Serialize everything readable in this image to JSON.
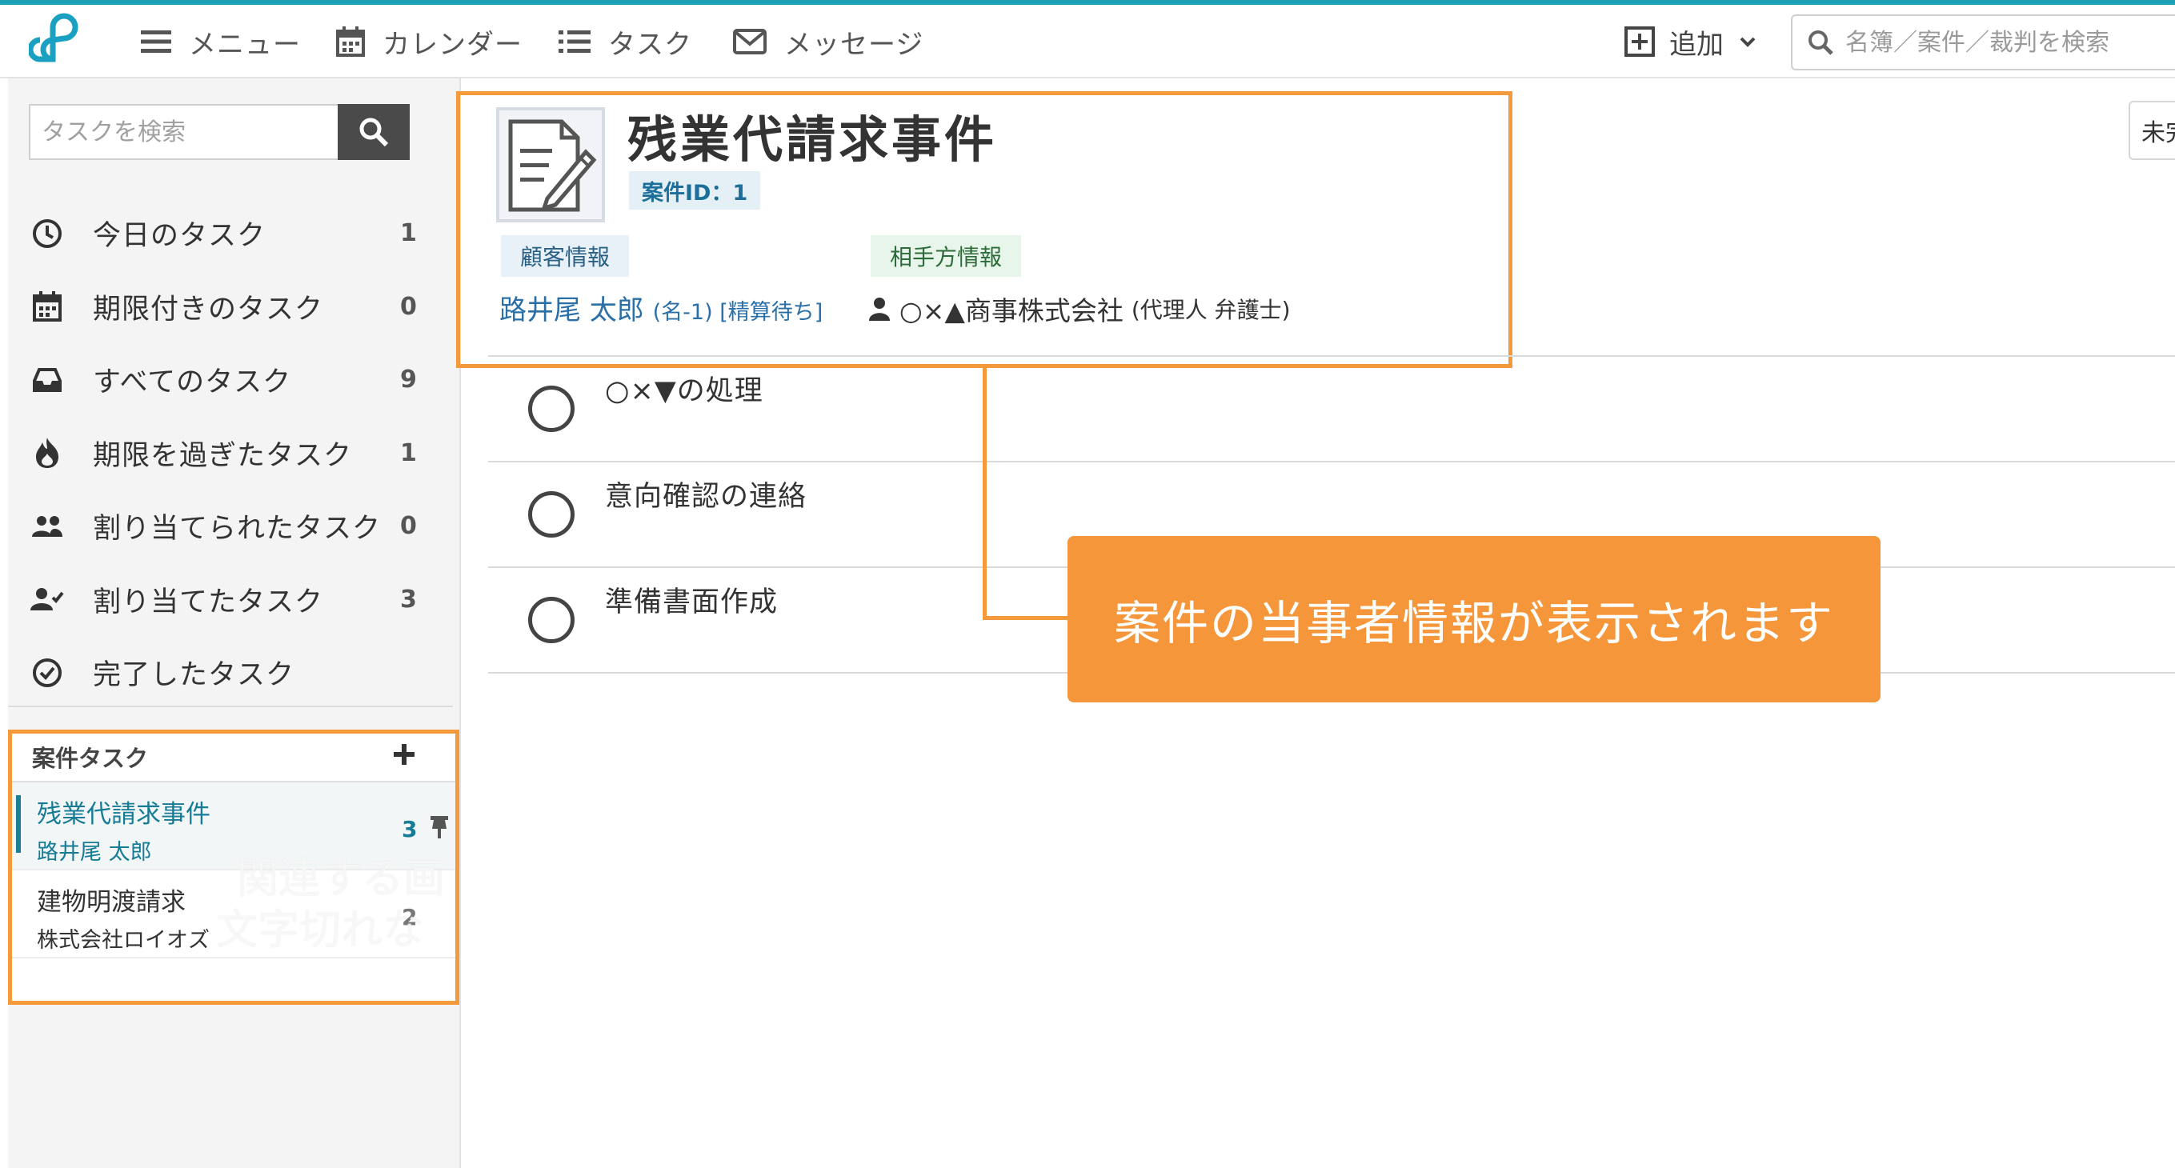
{
  "topbar": {
    "menu_label": "メニュー",
    "calendar_label": "カレンダー",
    "task_label": "タスク",
    "message_label": "メッセージ",
    "add_label": "追加",
    "search_placeholder": "名簿／案件／裁判を検索"
  },
  "sidebar": {
    "search_placeholder": "タスクを検索",
    "items": [
      {
        "label": "今日のタスク",
        "count": "1",
        "icon": "clock-icon"
      },
      {
        "label": "期限付きのタスク",
        "count": "0",
        "icon": "calendar-icon"
      },
      {
        "label": "すべてのタスク",
        "count": "9",
        "icon": "inbox-icon"
      },
      {
        "label": "期限を過ぎたタスク",
        "count": "1",
        "icon": "fire-icon"
      },
      {
        "label": "割り当てられたタスク",
        "count": "0",
        "icon": "users-icon"
      },
      {
        "label": "割り当てたタスク",
        "count": "3",
        "icon": "user-check-icon"
      },
      {
        "label": "完了したタスク",
        "count": "",
        "icon": "check-circle-icon"
      }
    ],
    "case_tasks": {
      "title": "案件タスク",
      "cases": [
        {
          "title": "残業代請求事件",
          "client": "路井尾 太郎",
          "count": "3"
        },
        {
          "title": "建物明渡請求",
          "client": "株式会社ロイオズ",
          "count": "2"
        }
      ],
      "overlay_text_1": "関連する画",
      "overlay_text_2": "文字切れな"
    }
  },
  "case": {
    "title": "残業代請求事件",
    "case_id": "案件ID：1",
    "client_tag": "顧客情報",
    "client_name": "路井尾 太郎",
    "client_detail": "(名-1) [精算待ち]",
    "opponent_tag": "相手方情報",
    "opponent_name": "○×▲商事株式会社",
    "opponent_detail": "(代理人 弁護士)",
    "status_button": "未完"
  },
  "tasks": [
    {
      "name": "○×▼の処理"
    },
    {
      "name": "意向確認の連絡"
    },
    {
      "name": "準備書面作成"
    }
  ],
  "callout": {
    "text": "案件の当事者情報が表示されます"
  },
  "colors": {
    "accent": "#1ba0b6",
    "callout": "#f5963a",
    "highlight_border": "#f59a3b",
    "active_case": "#167b94"
  }
}
